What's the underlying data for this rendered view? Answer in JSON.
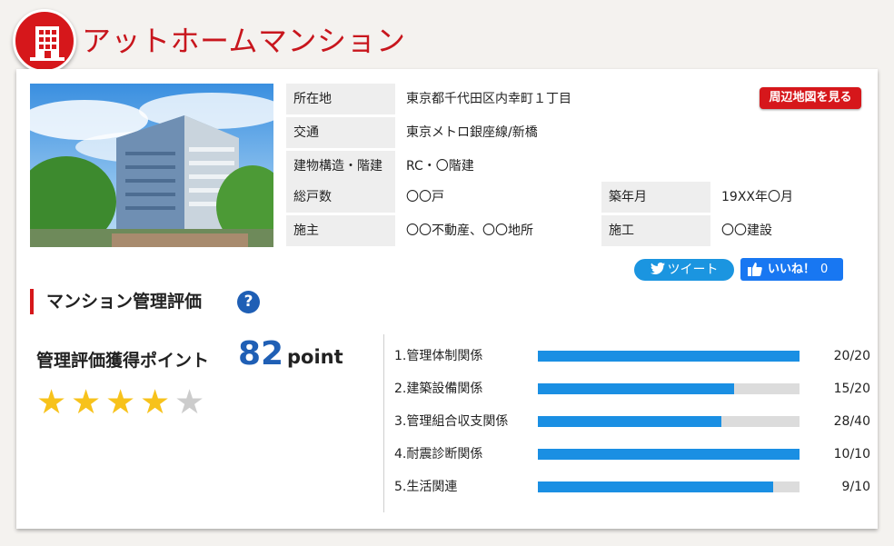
{
  "header": {
    "title": "アットホームマンション",
    "logo_icon": "building-icon"
  },
  "property": {
    "map_button": "周辺地図を見る",
    "rows": [
      {
        "label": "所在地",
        "value": "東京都千代田区内幸町１丁目"
      },
      {
        "label": "交通",
        "value": "東京メトロ銀座線/新橋"
      },
      {
        "label": "建物構造・階建",
        "value": "RC・〇階建"
      },
      {
        "label": "総戸数",
        "value": "〇〇戸",
        "label2": "築年月",
        "value2": "19XX年〇月"
      },
      {
        "label": "施主",
        "value": "〇〇不動産、〇〇地所",
        "label2": "施工",
        "value2": "〇〇建設"
      }
    ]
  },
  "social": {
    "tweet_label": "ツイート",
    "like_label": "いいね！",
    "like_count": "0"
  },
  "evaluation": {
    "section_title": "マンション管理評価",
    "help_icon_text": "?",
    "points_label": "管理評価獲得ポイント",
    "points_value": "82",
    "points_unit": "point",
    "stars_filled": 4,
    "stars_total": 5,
    "categories": [
      {
        "name": "1.管理体制関係",
        "score": 20,
        "max": 20,
        "display": "20/20"
      },
      {
        "name": "2.建築設備関係",
        "score": 15,
        "max": 20,
        "display": "15/20"
      },
      {
        "name": "3.管理組合収支関係",
        "score": 28,
        "max": 40,
        "display": "28/40"
      },
      {
        "name": "4.耐震診断関係",
        "score": 10,
        "max": 10,
        "display": "10/10"
      },
      {
        "name": "5.生活関連",
        "score": 9,
        "max": 10,
        "display": "9/10"
      }
    ]
  },
  "colors": {
    "brand_red": "#d6171b",
    "accent_blue": "#1f5fb5",
    "bar_blue": "#1a8fe3",
    "star_gold": "#f7c21b",
    "star_gray": "#cccccc"
  }
}
